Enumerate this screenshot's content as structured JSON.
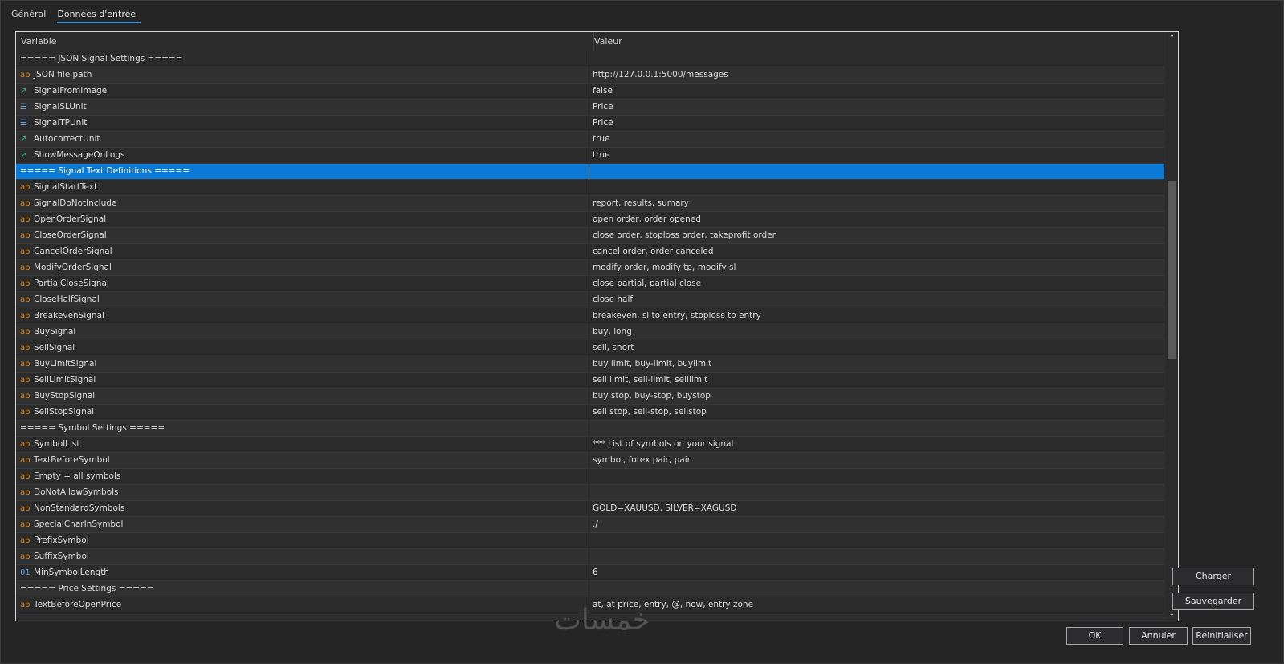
{
  "tabs": [
    "Général",
    "Données d'entrée"
  ],
  "active_tab": 1,
  "grid": {
    "header_variable": "Variable",
    "header_value": "Valeur",
    "rows": [
      {
        "icon": "",
        "variable": "===== JSON Signal Settings =====",
        "value": "",
        "selected": false
      },
      {
        "icon": "ab",
        "variable": "JSON file path",
        "value": "http://127.0.0.1:5000/messages",
        "selected": false
      },
      {
        "icon": "bool",
        "variable": "SignalFromImage",
        "value": "false",
        "selected": false
      },
      {
        "icon": "enum",
        "variable": "SignalSLUnit",
        "value": "Price",
        "selected": false
      },
      {
        "icon": "enum",
        "variable": "SignalTPUnit",
        "value": "Price",
        "selected": false
      },
      {
        "icon": "bool",
        "variable": "AutocorrectUnit",
        "value": "true",
        "selected": false
      },
      {
        "icon": "bool",
        "variable": "ShowMessageOnLogs",
        "value": "true",
        "selected": false
      },
      {
        "icon": "",
        "variable": "===== Signal Text Definitions =====",
        "value": "",
        "selected": true
      },
      {
        "icon": "ab",
        "variable": "SignalStartText",
        "value": "",
        "selected": false
      },
      {
        "icon": "ab",
        "variable": "SignalDoNotInclude",
        "value": "report, results, sumary",
        "selected": false
      },
      {
        "icon": "ab",
        "variable": "OpenOrderSignal",
        "value": "open order, order opened",
        "selected": false
      },
      {
        "icon": "ab",
        "variable": "CloseOrderSignal",
        "value": "close order, stoploss order, takeprofit order",
        "selected": false
      },
      {
        "icon": "ab",
        "variable": "CancelOrderSignal",
        "value": "cancel order, order canceled",
        "selected": false
      },
      {
        "icon": "ab",
        "variable": "ModifyOrderSignal",
        "value": "modify order, modify tp, modify sl",
        "selected": false
      },
      {
        "icon": "ab",
        "variable": "PartialCloseSignal",
        "value": "close partial, partial close",
        "selected": false
      },
      {
        "icon": "ab",
        "variable": "CloseHalfSignal",
        "value": "close half",
        "selected": false
      },
      {
        "icon": "ab",
        "variable": "BreakevenSignal",
        "value": "breakeven, sl to entry, stoploss to entry",
        "selected": false
      },
      {
        "icon": "ab",
        "variable": "BuySignal",
        "value": "buy, long",
        "selected": false
      },
      {
        "icon": "ab",
        "variable": "SellSignal",
        "value": "sell, short",
        "selected": false
      },
      {
        "icon": "ab",
        "variable": "BuyLimitSignal",
        "value": "buy limit, buy-limit, buylimit",
        "selected": false
      },
      {
        "icon": "ab",
        "variable": "SellLimitSignal",
        "value": "sell limit, sell-limit, selllimit",
        "selected": false
      },
      {
        "icon": "ab",
        "variable": "BuyStopSignal",
        "value": "buy stop, buy-stop, buystop",
        "selected": false
      },
      {
        "icon": "ab",
        "variable": "SellStopSignal",
        "value": "sell stop, sell-stop, sellstop",
        "selected": false
      },
      {
        "icon": "",
        "variable": "===== Symbol Settings =====",
        "value": "",
        "selected": false
      },
      {
        "icon": "ab",
        "variable": "SymbolList",
        "value": "*** List of symbols on your signal",
        "selected": false
      },
      {
        "icon": "ab",
        "variable": "TextBeforeSymbol",
        "value": "symbol, forex pair, pair",
        "selected": false
      },
      {
        "icon": "ab",
        "variable": "Empty = all symbols",
        "value": "",
        "selected": false
      },
      {
        "icon": "ab",
        "variable": "DoNotAllowSymbols",
        "value": "",
        "selected": false
      },
      {
        "icon": "ab",
        "variable": "NonStandardSymbols",
        "value": "GOLD=XAUUSD, SILVER=XAGUSD",
        "selected": false
      },
      {
        "icon": "ab",
        "variable": "SpecialCharInSymbol",
        "value": "./",
        "selected": false
      },
      {
        "icon": "ab",
        "variable": "PrefixSymbol",
        "value": "",
        "selected": false
      },
      {
        "icon": "ab",
        "variable": "SuffixSymbol",
        "value": "",
        "selected": false
      },
      {
        "icon": "num",
        "variable": "MinSymbolLength",
        "value": "6",
        "selected": false
      },
      {
        "icon": "",
        "variable": "===== Price Settings =====",
        "value": "",
        "selected": false
      },
      {
        "icon": "ab",
        "variable": "TextBeforeOpenPrice",
        "value": "at, at price, entry, @, now, entry zone",
        "selected": false
      }
    ]
  },
  "scroll_position": 0.3,
  "icons": {
    "ab": "ab",
    "bool": "↗",
    "enum": "☰",
    "num": "01",
    "scroll_up": "⌃",
    "scroll_down": "⌄"
  },
  "buttons": {
    "load": "Charger",
    "save": "Sauvegarder",
    "ok": "OK",
    "cancel": "Annuler",
    "reset": "Réinitialiser"
  },
  "watermark": "خمسات",
  "colors": {
    "accent": "#0a7ad6",
    "string_icon": "#d18a2a",
    "bool_icon": "#2bb673",
    "enum_icon": "#6fa8dc",
    "num_icon": "#4fa3e8"
  }
}
